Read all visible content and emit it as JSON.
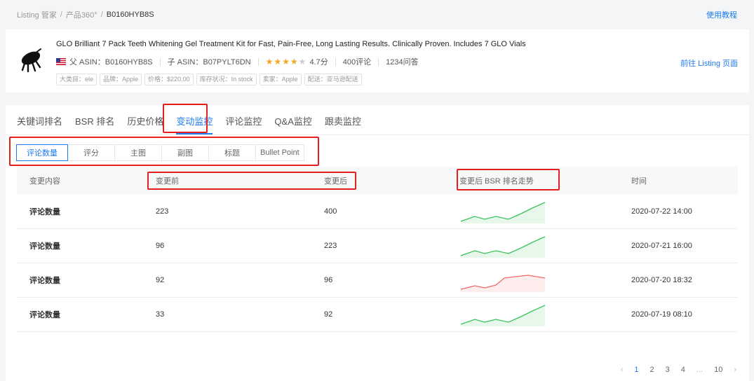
{
  "breadcrumb": {
    "items": [
      "Listing 管家",
      "产品360°"
    ],
    "current": "B0160HYB8S"
  },
  "help_link": "使用教程",
  "product": {
    "title": "GLO Brilliant 7 Pack Teeth Whitening Gel Treatment Kit for Fast, Pain-Free, Long Lasting Results. Clinically Proven. Includes 7 GLO Vials",
    "parent_asin": "父 ASIN：B0160HYB8S",
    "child_asin": "子 ASIN：B07PYLT6DN",
    "rating": "4.7分",
    "rating_value": 4,
    "reviews": "400评论",
    "qa": "1234问答",
    "tags": [
      "大类目：ele",
      "品牌：Apple",
      "价格：$220.00",
      "库存状况：In stock",
      "卖家：Apple",
      "配送：亚马逊配送"
    ],
    "goto_link": "前往 Listing 页面"
  },
  "tabs": [
    "关键词排名",
    "BSR 排名",
    "历史价格",
    "变动监控",
    "评论监控",
    "Q&A监控",
    "跟卖监控"
  ],
  "active_tab": 3,
  "sub_tabs": [
    "评论数量",
    "评分",
    "主图",
    "副图",
    "标题",
    "Bullet Point"
  ],
  "active_sub_tab": 0,
  "table": {
    "headers": [
      "变更内容",
      "变更前",
      "变更后",
      "变更后 BSR 排名走势",
      "时间"
    ],
    "rows": [
      {
        "content": "评论数量",
        "before": "223",
        "after": "400",
        "trend": "up",
        "time": "2020-07-22  14:00"
      },
      {
        "content": "评论数量",
        "before": "96",
        "after": "223",
        "trend": "up",
        "time": "2020-07-21  16:00"
      },
      {
        "content": "评论数量",
        "before": "92",
        "after": "96",
        "trend": "down",
        "time": "2020-07-20  18:32"
      },
      {
        "content": "评论数量",
        "before": "33",
        "after": "92",
        "trend": "up",
        "time": "2020-07-19  08:10"
      }
    ]
  },
  "pagination": {
    "prev": "‹",
    "pages": [
      "1",
      "2",
      "3",
      "4",
      "...",
      "10"
    ],
    "active": 0,
    "next": "›"
  },
  "colors": {
    "accent": "#1e7bf0",
    "highlight": "#e61e1e",
    "trend_up": "#38c25b",
    "trend_down": "#f06a6a"
  }
}
